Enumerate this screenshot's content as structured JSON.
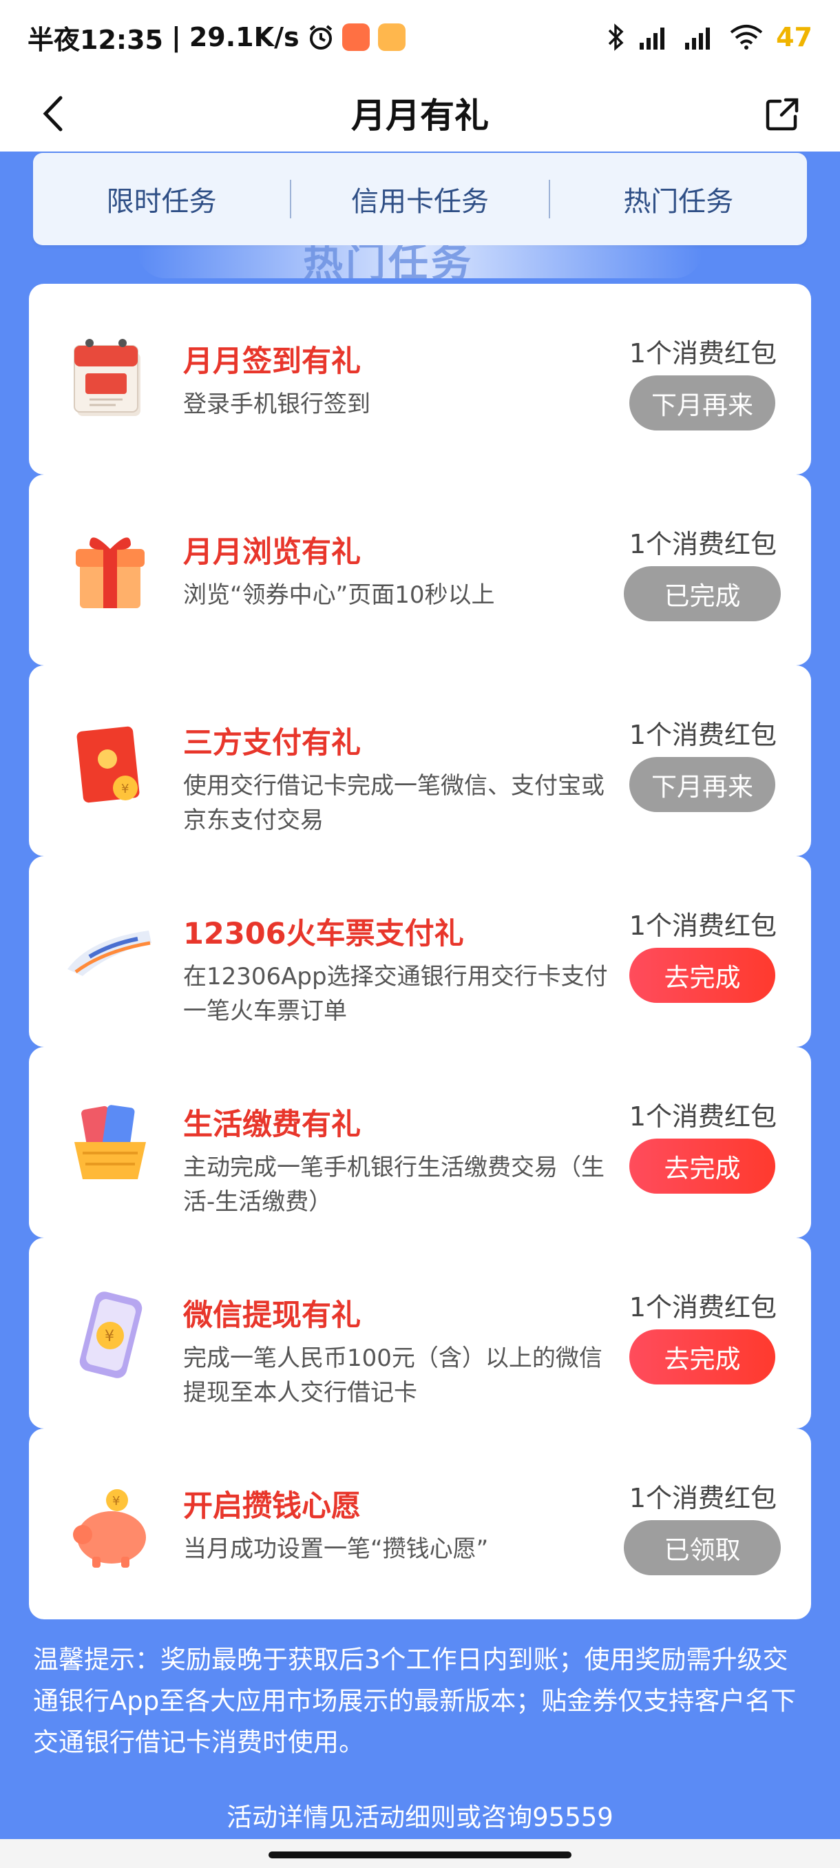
{
  "status_bar": {
    "time": "半夜12:35",
    "network_speed": "29.1K/s",
    "battery": "47",
    "battery_color": "#f0b400"
  },
  "nav": {
    "title": "月月有礼",
    "back_icon": "chevron-left-icon",
    "share_icon": "share-icon"
  },
  "tabs": [
    {
      "label": "限时任务"
    },
    {
      "label": "信用卡任务"
    },
    {
      "label": "热门任务"
    }
  ],
  "banner": {
    "text": "热门任务"
  },
  "tasks": [
    {
      "title": "月月签到有礼",
      "desc": "登录手机银行签到",
      "reward": "1个消费红包",
      "button": "下月再来",
      "state": "gray",
      "icon": "calendar-icon"
    },
    {
      "title": "月月浏览有礼",
      "desc": "浏览“领券中心”页面10秒以上",
      "reward": "1个消费红包",
      "button": "已完成",
      "state": "gray",
      "icon": "gift-box-icon"
    },
    {
      "title": "三方支付有礼",
      "desc": "使用交行借记卡完成一笔微信、支付宝或京东支付交易",
      "reward": "1个消费红包",
      "button": "下月再来",
      "state": "gray",
      "icon": "red-envelope-icon"
    },
    {
      "title": "12306火车票支付礼",
      "desc": "在12306App选择交通银行用交行卡支付一笔火车票订单",
      "reward": "1个消费红包",
      "button": "去完成",
      "state": "red",
      "icon": "train-icon"
    },
    {
      "title": "生活缴费有礼",
      "desc": "主动完成一笔手机银行生活缴费交易（生活-生活缴费）",
      "reward": "1个消费红包",
      "button": "去完成",
      "state": "red",
      "icon": "shopping-basket-icon"
    },
    {
      "title": "微信提现有礼",
      "desc": "完成一笔人民币100元（含）以上的微信提现至本人交行借记卡",
      "reward": "1个消费红包",
      "button": "去完成",
      "state": "red",
      "icon": "phone-coin-icon"
    },
    {
      "title": "开启攒钱心愿",
      "desc": "当月成功设置一笔“攒钱心愿”",
      "reward": "1个消费红包",
      "button": "已领取",
      "state": "gray",
      "icon": "piggy-bank-icon"
    }
  ],
  "tip": "温馨提示：奖励最晚于获取后3个工作日内到账；使用奖励需升级交通银行App至各大应用市场展示的最新版本；贴金券仅支持客户名下交通银行借记卡消费时使用。",
  "footer": "活动详情见活动细则或咨询95559",
  "colors": {
    "background": "#5b8bf5",
    "title_red": "#e8362b",
    "button_red": "#ff3a2e",
    "button_gray": "#9e9e9e",
    "tab_text": "#2f4f86"
  }
}
